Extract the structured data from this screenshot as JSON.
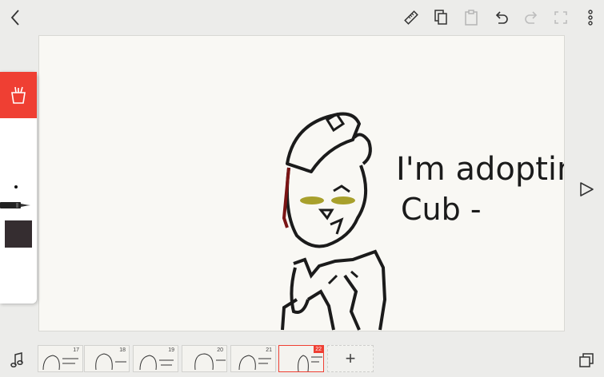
{
  "top_bar": {
    "back_icon": "chevron-left-icon",
    "actions": [
      "ruler-icon",
      "copy-icon",
      "paste-icon",
      "undo-icon",
      "redo-icon",
      "fullscreen-icon",
      "more-icon"
    ]
  },
  "canvas": {
    "drawing_text_line1": "I'm adopting",
    "drawing_text_line2": "Cub -"
  },
  "tool_panel": {
    "tab_icon": "brush-cup-icon",
    "pen_icon": "fineliner-pen-icon",
    "active_color": "#352d30"
  },
  "play_icon": "play-icon",
  "timeline": {
    "frames": [
      {
        "number": "17"
      },
      {
        "number": "18"
      },
      {
        "number": "19"
      },
      {
        "number": "20"
      },
      {
        "number": "21"
      },
      {
        "number": "22",
        "selected": true
      }
    ],
    "add_label": "+"
  },
  "music_icon": "music-note-icon",
  "layers_icon": "layers-icon",
  "colors": {
    "accent": "#ef3f33",
    "background": "#ececea",
    "canvas": "#f9f8f4"
  }
}
